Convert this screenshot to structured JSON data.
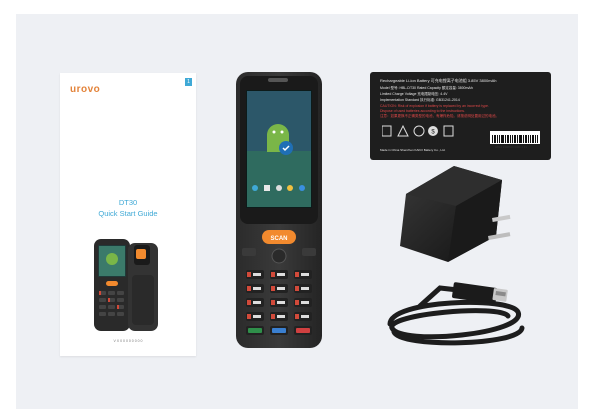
{
  "guide": {
    "brand": "urovo",
    "badge": "1",
    "model": "DT30",
    "title": "Quick Start Guide",
    "code": "V X 0 0 0 0 0 0 0 0"
  },
  "device": {
    "scan_label": "SCAN"
  },
  "battery": {
    "header": "Rechargeable Li-ion Battery  可充电锂离子电池组  3.85V  3800mAh",
    "model": "Model 型号: HBL-DT30   Rated Capacity 额定容量: 3800mAh",
    "voltage": "Limited Charge Voltage 充电限制电压: 4.4V",
    "standard": "Implementation Standard 执行标准: GB31241-2014",
    "warning1": "CAUTION: Risk of explosion if battery is replaced by an incorrect type.",
    "warning2": "Dispose of used batteries according to the instructions.",
    "warning3": "注意：如果更换不正确类型的电池，有爆炸危险。请按说明处置用过的电池。",
    "maker": "Made in China  Shenzhen KAKO Battery Co., Ltd.",
    "serial": "HBL4 1908010 0001 2 43"
  }
}
